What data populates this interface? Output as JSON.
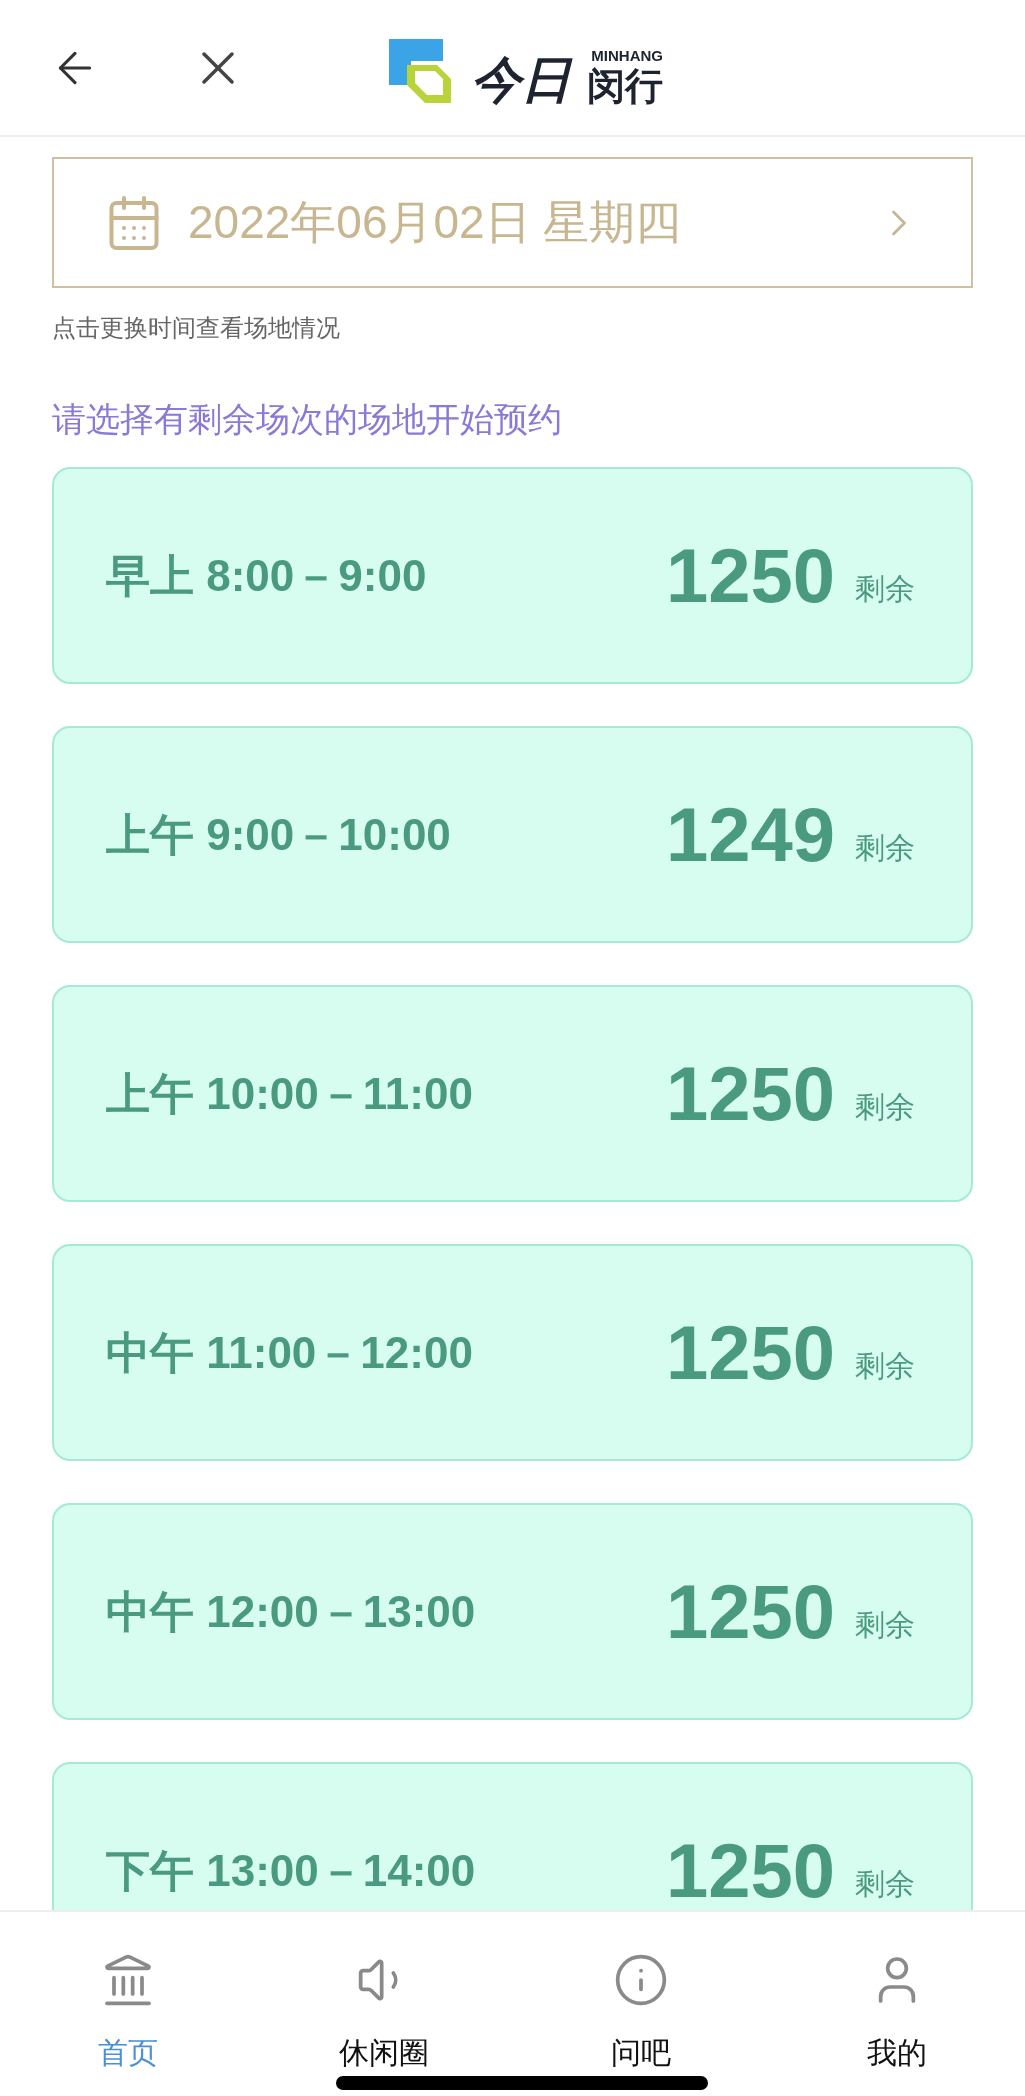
{
  "header": {
    "logo": {
      "brand": "今日",
      "latin": "MINHANG",
      "name": "闵行"
    }
  },
  "date_picker": {
    "value": "2022年06月02日 星期四"
  },
  "hint": "点击更换时间查看场地情况",
  "heading": "请选择有剩余场次的场地开始预约",
  "slots": [
    {
      "period": "早上",
      "time": "8:00－9:00",
      "count": "1250",
      "unit": "剩余"
    },
    {
      "period": "上午",
      "time": "9:00－10:00",
      "count": "1249",
      "unit": "剩余"
    },
    {
      "period": "上午",
      "time": "10:00－11:00",
      "count": "1250",
      "unit": "剩余"
    },
    {
      "period": "中午",
      "time": "11:00－12:00",
      "count": "1250",
      "unit": "剩余"
    },
    {
      "period": "中午",
      "time": "12:00－13:00",
      "count": "1250",
      "unit": "剩余"
    },
    {
      "period": "下午",
      "time": "13:00－14:00",
      "count": "1250",
      "unit": "剩余"
    }
  ],
  "tab_bar": [
    {
      "kind": "home",
      "label": "首页",
      "selected": true
    },
    {
      "kind": "leisure",
      "label": "休闲圈",
      "selected": false
    },
    {
      "kind": "ask",
      "label": "问吧",
      "selected": false
    },
    {
      "kind": "me",
      "label": "我的",
      "selected": false
    }
  ]
}
